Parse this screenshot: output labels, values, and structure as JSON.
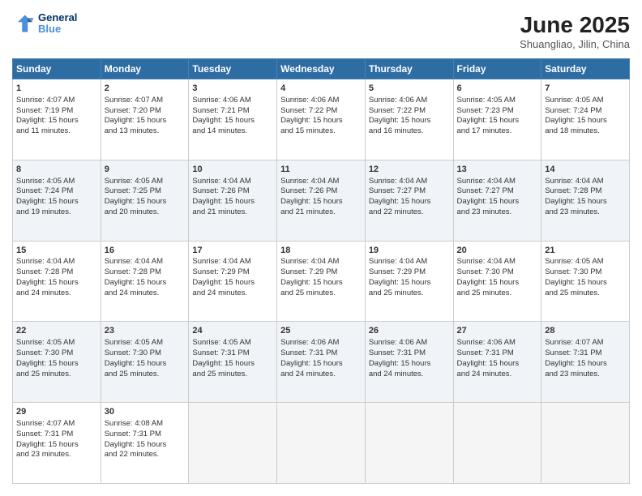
{
  "header": {
    "logo_line1": "General",
    "logo_line2": "Blue",
    "month": "June 2025",
    "location": "Shuangliao, Jilin, China"
  },
  "days_of_week": [
    "Sunday",
    "Monday",
    "Tuesday",
    "Wednesday",
    "Thursday",
    "Friday",
    "Saturday"
  ],
  "weeks": [
    [
      {
        "day": 1,
        "lines": [
          "Sunrise: 4:07 AM",
          "Sunset: 7:19 PM",
          "Daylight: 15 hours",
          "and 11 minutes."
        ]
      },
      {
        "day": 2,
        "lines": [
          "Sunrise: 4:07 AM",
          "Sunset: 7:20 PM",
          "Daylight: 15 hours",
          "and 13 minutes."
        ]
      },
      {
        "day": 3,
        "lines": [
          "Sunrise: 4:06 AM",
          "Sunset: 7:21 PM",
          "Daylight: 15 hours",
          "and 14 minutes."
        ]
      },
      {
        "day": 4,
        "lines": [
          "Sunrise: 4:06 AM",
          "Sunset: 7:22 PM",
          "Daylight: 15 hours",
          "and 15 minutes."
        ]
      },
      {
        "day": 5,
        "lines": [
          "Sunrise: 4:06 AM",
          "Sunset: 7:22 PM",
          "Daylight: 15 hours",
          "and 16 minutes."
        ]
      },
      {
        "day": 6,
        "lines": [
          "Sunrise: 4:05 AM",
          "Sunset: 7:23 PM",
          "Daylight: 15 hours",
          "and 17 minutes."
        ]
      },
      {
        "day": 7,
        "lines": [
          "Sunrise: 4:05 AM",
          "Sunset: 7:24 PM",
          "Daylight: 15 hours",
          "and 18 minutes."
        ]
      }
    ],
    [
      {
        "day": 8,
        "lines": [
          "Sunrise: 4:05 AM",
          "Sunset: 7:24 PM",
          "Daylight: 15 hours",
          "and 19 minutes."
        ]
      },
      {
        "day": 9,
        "lines": [
          "Sunrise: 4:05 AM",
          "Sunset: 7:25 PM",
          "Daylight: 15 hours",
          "and 20 minutes."
        ]
      },
      {
        "day": 10,
        "lines": [
          "Sunrise: 4:04 AM",
          "Sunset: 7:26 PM",
          "Daylight: 15 hours",
          "and 21 minutes."
        ]
      },
      {
        "day": 11,
        "lines": [
          "Sunrise: 4:04 AM",
          "Sunset: 7:26 PM",
          "Daylight: 15 hours",
          "and 21 minutes."
        ]
      },
      {
        "day": 12,
        "lines": [
          "Sunrise: 4:04 AM",
          "Sunset: 7:27 PM",
          "Daylight: 15 hours",
          "and 22 minutes."
        ]
      },
      {
        "day": 13,
        "lines": [
          "Sunrise: 4:04 AM",
          "Sunset: 7:27 PM",
          "Daylight: 15 hours",
          "and 23 minutes."
        ]
      },
      {
        "day": 14,
        "lines": [
          "Sunrise: 4:04 AM",
          "Sunset: 7:28 PM",
          "Daylight: 15 hours",
          "and 23 minutes."
        ]
      }
    ],
    [
      {
        "day": 15,
        "lines": [
          "Sunrise: 4:04 AM",
          "Sunset: 7:28 PM",
          "Daylight: 15 hours",
          "and 24 minutes."
        ]
      },
      {
        "day": 16,
        "lines": [
          "Sunrise: 4:04 AM",
          "Sunset: 7:28 PM",
          "Daylight: 15 hours",
          "and 24 minutes."
        ]
      },
      {
        "day": 17,
        "lines": [
          "Sunrise: 4:04 AM",
          "Sunset: 7:29 PM",
          "Daylight: 15 hours",
          "and 24 minutes."
        ]
      },
      {
        "day": 18,
        "lines": [
          "Sunrise: 4:04 AM",
          "Sunset: 7:29 PM",
          "Daylight: 15 hours",
          "and 25 minutes."
        ]
      },
      {
        "day": 19,
        "lines": [
          "Sunrise: 4:04 AM",
          "Sunset: 7:29 PM",
          "Daylight: 15 hours",
          "and 25 minutes."
        ]
      },
      {
        "day": 20,
        "lines": [
          "Sunrise: 4:04 AM",
          "Sunset: 7:30 PM",
          "Daylight: 15 hours",
          "and 25 minutes."
        ]
      },
      {
        "day": 21,
        "lines": [
          "Sunrise: 4:05 AM",
          "Sunset: 7:30 PM",
          "Daylight: 15 hours",
          "and 25 minutes."
        ]
      }
    ],
    [
      {
        "day": 22,
        "lines": [
          "Sunrise: 4:05 AM",
          "Sunset: 7:30 PM",
          "Daylight: 15 hours",
          "and 25 minutes."
        ]
      },
      {
        "day": 23,
        "lines": [
          "Sunrise: 4:05 AM",
          "Sunset: 7:30 PM",
          "Daylight: 15 hours",
          "and 25 minutes."
        ]
      },
      {
        "day": 24,
        "lines": [
          "Sunrise: 4:05 AM",
          "Sunset: 7:31 PM",
          "Daylight: 15 hours",
          "and 25 minutes."
        ]
      },
      {
        "day": 25,
        "lines": [
          "Sunrise: 4:06 AM",
          "Sunset: 7:31 PM",
          "Daylight: 15 hours",
          "and 24 minutes."
        ]
      },
      {
        "day": 26,
        "lines": [
          "Sunrise: 4:06 AM",
          "Sunset: 7:31 PM",
          "Daylight: 15 hours",
          "and 24 minutes."
        ]
      },
      {
        "day": 27,
        "lines": [
          "Sunrise: 4:06 AM",
          "Sunset: 7:31 PM",
          "Daylight: 15 hours",
          "and 24 minutes."
        ]
      },
      {
        "day": 28,
        "lines": [
          "Sunrise: 4:07 AM",
          "Sunset: 7:31 PM",
          "Daylight: 15 hours",
          "and 23 minutes."
        ]
      }
    ],
    [
      {
        "day": 29,
        "lines": [
          "Sunrise: 4:07 AM",
          "Sunset: 7:31 PM",
          "Daylight: 15 hours",
          "and 23 minutes."
        ]
      },
      {
        "day": 30,
        "lines": [
          "Sunrise: 4:08 AM",
          "Sunset: 7:31 PM",
          "Daylight: 15 hours",
          "and 22 minutes."
        ]
      },
      null,
      null,
      null,
      null,
      null
    ]
  ]
}
